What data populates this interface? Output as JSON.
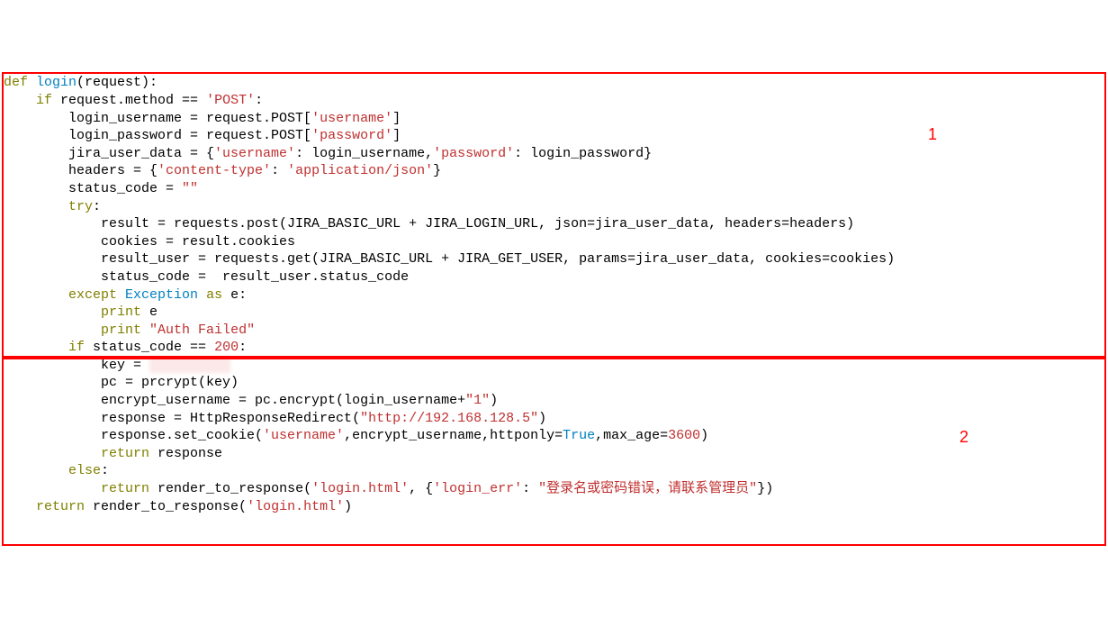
{
  "labels": {
    "box1": "1",
    "box2": "2"
  },
  "code": {
    "l1_def": "def",
    "l1_fn": "login",
    "l1_rest": "(request):",
    "l2_if": "if",
    "l2_rest": " request.method == ",
    "l2_str": "'POST'",
    "l2_colon": ":",
    "l3_a": "        login_username = request.POST[",
    "l3_str": "'username'",
    "l3_b": "]",
    "l4_a": "        login_password = request.POST[",
    "l4_str": "'password'",
    "l4_b": "]",
    "l5_a": "        jira_user_data = {",
    "l5_s1": "'username'",
    "l5_b": ": login_username,",
    "l5_s2": "'password'",
    "l5_c": ": login_password}",
    "l6_a": "        headers = {",
    "l6_s1": "'content-type'",
    "l6_b": ": ",
    "l6_s2": "'application/json'",
    "l6_c": "}",
    "l7_a": "        status_code = ",
    "l7_s": "\"\"",
    "l8_try": "try",
    "l8_colon": ":",
    "l9": "            result = requests.post(JIRA_BASIC_URL + JIRA_LOGIN_URL, json=jira_user_data, headers=headers)",
    "l10": "            cookies = result.cookies",
    "l11": "            result_user = requests.get(JIRA_BASIC_URL + JIRA_GET_USER, params=jira_user_data, cookies=cookies)",
    "l12": "            status_code =  result_user.status_code",
    "l13_except": "except",
    "l13_exc": " Exception ",
    "l13_as": "as",
    "l13_rest": " e:",
    "l14_print": "print",
    "l14_rest": " e",
    "l15_print": "print",
    "l15_str": " \"Auth Failed\"",
    "l16_if": "if",
    "l16_rest": " status_code == ",
    "l16_num": "200",
    "l16_colon": ":",
    "l17_a": "            key = ",
    "l17_blur": "          ",
    "l18": "            pc = prcrypt(key)",
    "l19_a": "            encrypt_username = pc.encrypt(login_username+",
    "l19_s": "\"1\"",
    "l19_b": ")",
    "l20_a": "            response = HttpResponseRedirect(",
    "l20_s": "\"http://192.168.128.5\"",
    "l20_b": ")",
    "l21_a": "            response.set_cookie(",
    "l21_s": "'username'",
    "l21_b": ",encrypt_username,httponly=",
    "l21_true": "True",
    "l21_c": ",max_age=",
    "l21_num": "3600",
    "l21_d": ")",
    "l22_ret": "return",
    "l22_rest": " response",
    "l23_else": "else",
    "l23_colon": ":",
    "l24_ret": "return",
    "l24_a": " render_to_response(",
    "l24_s1": "'login.html'",
    "l24_b": ", {",
    "l24_s2": "'login_err'",
    "l24_c": ": ",
    "l24_s3": "\"登录名或密码错误，请联系管理员\"",
    "l24_d": "})",
    "l25_ret": "return",
    "l25_a": " render_to_response(",
    "l25_s": "'login.html'",
    "l25_b": ")"
  }
}
